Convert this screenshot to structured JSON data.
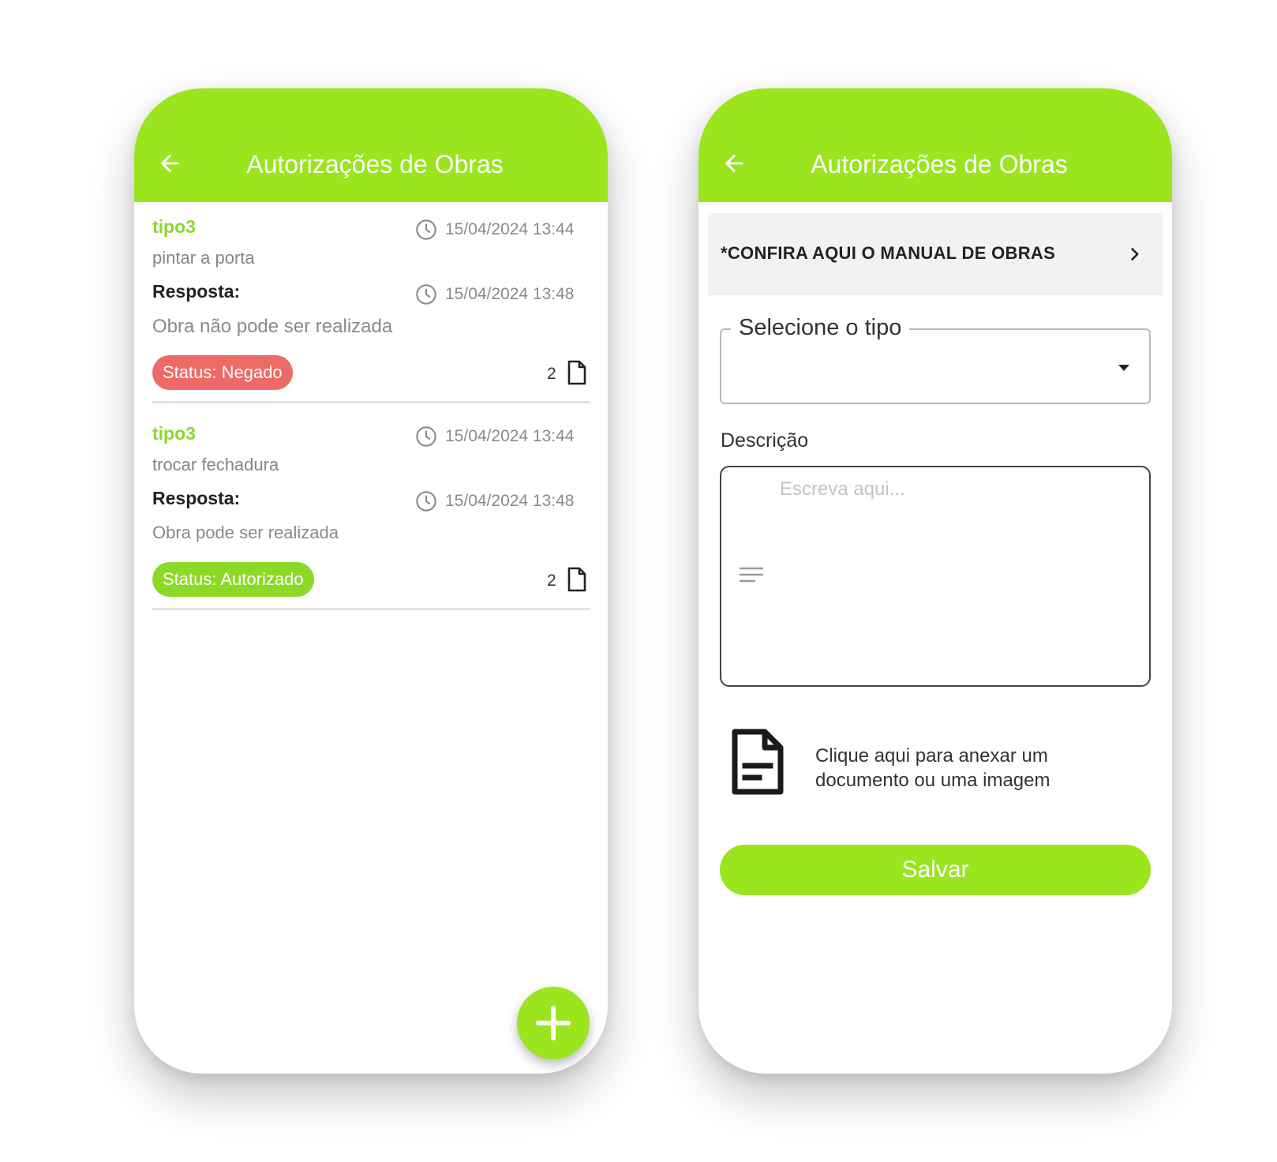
{
  "colors": {
    "accent": "#9ae51e",
    "denied": "#ee6a66",
    "authorized": "#8dd928"
  },
  "list_screen": {
    "title": "Autorizações de Obras",
    "items": [
      {
        "type": "tipo3",
        "description": "pintar a porta",
        "created_at": "15/04/2024 13:44",
        "response_label": "Resposta:",
        "response_at": "15/04/2024 13:48",
        "response_text": "Obra não pode ser realizada",
        "status": "Status: Negado",
        "attachments": "2"
      },
      {
        "type": "tipo3",
        "description": "trocar fechadura",
        "created_at": "15/04/2024 13:44",
        "response_label": "Resposta:",
        "response_at": "15/04/2024 13:48",
        "response_text": "Obra pode ser realizada",
        "status": "Status: Autorizado",
        "attachments": "2"
      }
    ],
    "fab_icon": "plus-icon"
  },
  "form_screen": {
    "title": "Autorizações de Obras",
    "manual_link": "*CONFIRA AQUI O MANUAL DE OBRAS",
    "type_select_label": "Selecione o tipo",
    "type_select_value": "",
    "description_label": "Descrição",
    "description_placeholder": "Escreva aqui...",
    "attach_text_line1": "Clique aqui para anexar um",
    "attach_text_line2": "documento ou uma imagem",
    "save_label": "Salvar"
  }
}
